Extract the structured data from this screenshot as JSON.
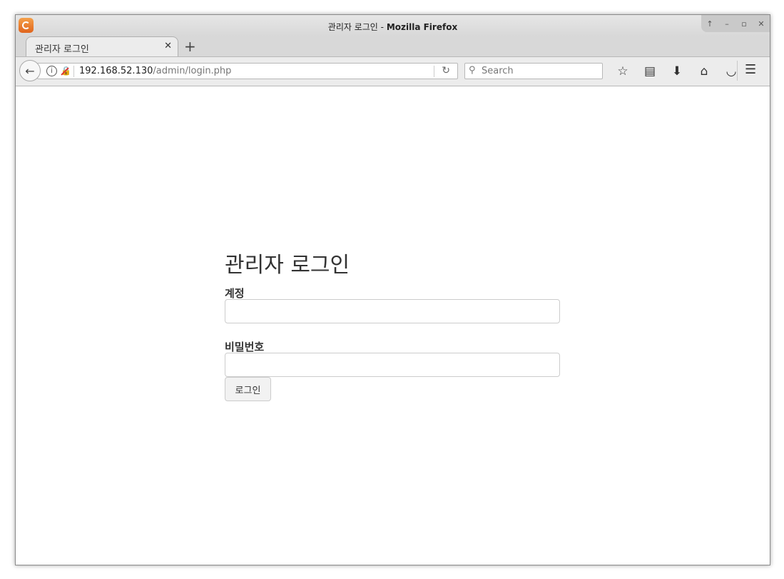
{
  "window": {
    "title_page": "관리자 로그인",
    "title_separator": " - ",
    "title_app": "Mozilla Firefox",
    "controls": [
      "↑",
      "–",
      "▫",
      "✕"
    ]
  },
  "tabs": [
    {
      "label": "관리자 로그인",
      "close": "✕"
    }
  ],
  "new_tab_label": "+",
  "navigation": {
    "back": "←",
    "url_host": "192.168.52.130",
    "url_path": "/admin/login.php",
    "reload": "↻",
    "search_placeholder": "Search",
    "toolbar_icons": [
      "star-icon",
      "reading-list-icon",
      "download-icon",
      "home-icon",
      "pocket-icon",
      "menu-icon"
    ]
  },
  "page": {
    "heading": "관리자 로그인",
    "account_label": "계정",
    "account_value": "",
    "password_label": "비밀번호",
    "password_value": "",
    "login_button": "로그인"
  },
  "colors": {
    "firefox_accent": "#e0641c",
    "insecure_indicator": "#dd3333"
  }
}
